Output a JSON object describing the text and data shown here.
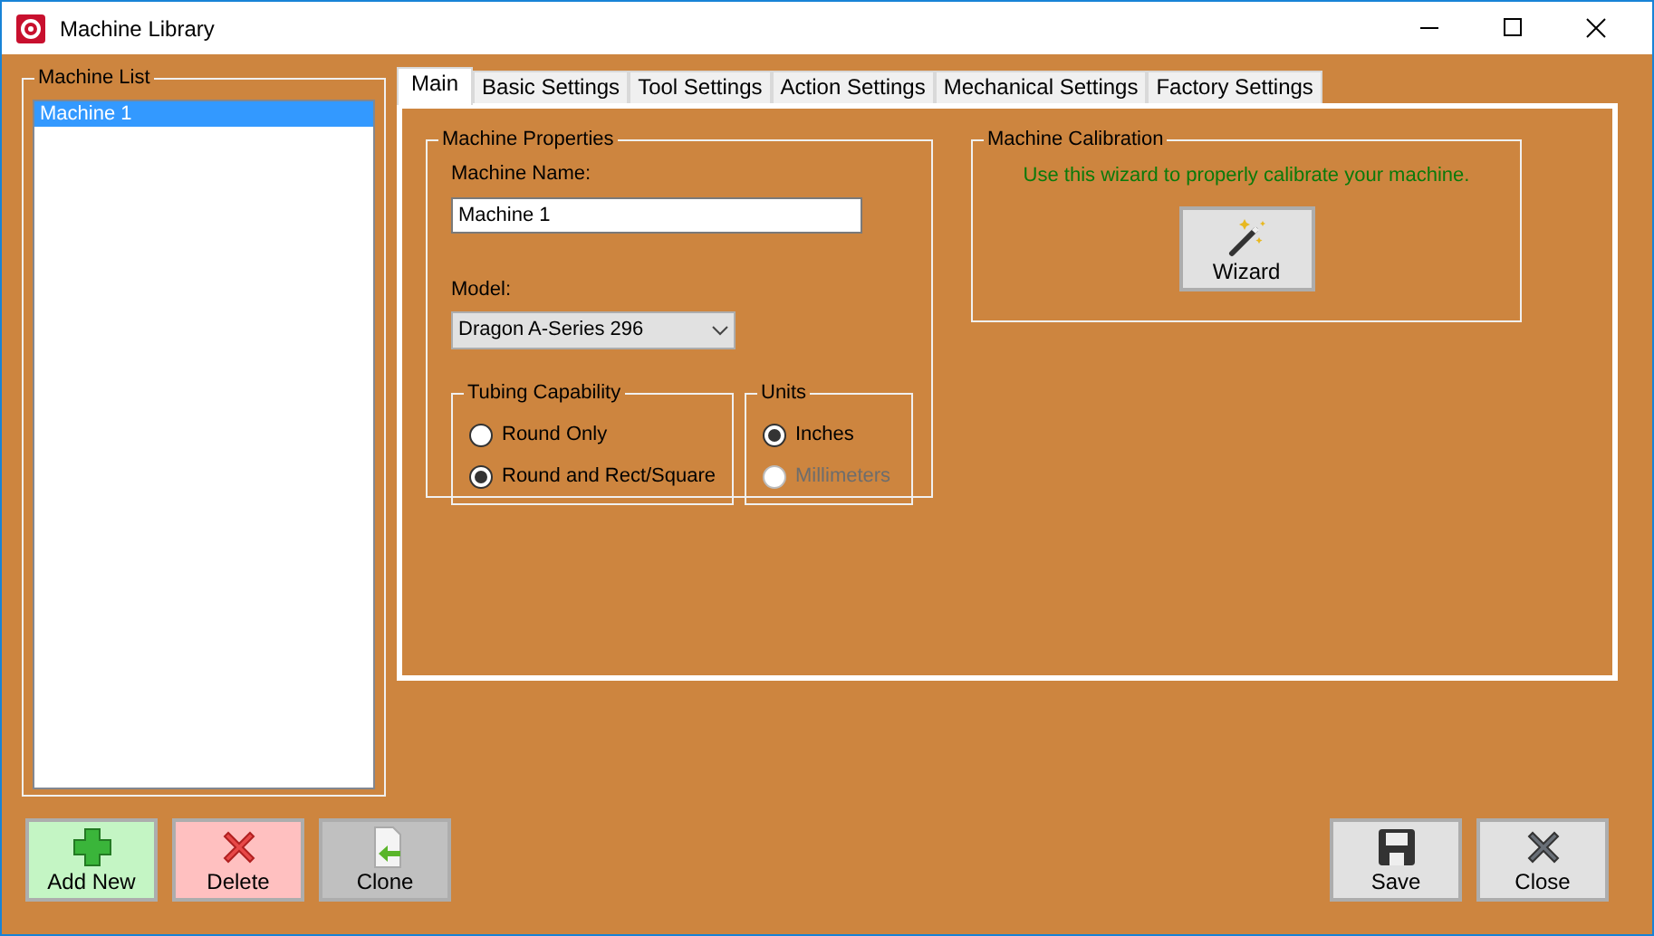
{
  "window": {
    "title": "Machine Library"
  },
  "machine_list": {
    "title": "Machine List",
    "items": [
      {
        "label": "Machine 1",
        "selected": true
      }
    ]
  },
  "tabs": [
    {
      "label": "Main",
      "selected": true
    },
    {
      "label": "Basic Settings",
      "selected": false
    },
    {
      "label": "Tool Settings",
      "selected": false
    },
    {
      "label": "Action Settings",
      "selected": false
    },
    {
      "label": "Mechanical Settings",
      "selected": false
    },
    {
      "label": "Factory Settings",
      "selected": false
    }
  ],
  "machine_properties": {
    "title": "Machine Properties",
    "name_label": "Machine Name:",
    "name_value": "Machine 1",
    "model_label": "Model:",
    "model_value": "Dragon A-Series 296",
    "tubing": {
      "title": "Tubing Capability",
      "options": [
        {
          "label": "Round Only",
          "selected": false,
          "disabled": false
        },
        {
          "label": "Round and Rect/Square",
          "selected": true,
          "disabled": false
        }
      ]
    },
    "units": {
      "title": "Units",
      "options": [
        {
          "label": "Inches",
          "selected": true,
          "disabled": false
        },
        {
          "label": "Millimeters",
          "selected": false,
          "disabled": true
        }
      ]
    }
  },
  "calibration": {
    "title": "Machine Calibration",
    "message": "Use this wizard to properly calibrate your machine.",
    "button": "Wizard"
  },
  "left_buttons": [
    {
      "label": "Add New",
      "kind": "add"
    },
    {
      "label": "Delete",
      "kind": "delete"
    },
    {
      "label": "Clone",
      "kind": "clone"
    }
  ],
  "right_buttons": [
    {
      "label": "Save",
      "kind": "save"
    },
    {
      "label": "Close",
      "kind": "close"
    }
  ]
}
